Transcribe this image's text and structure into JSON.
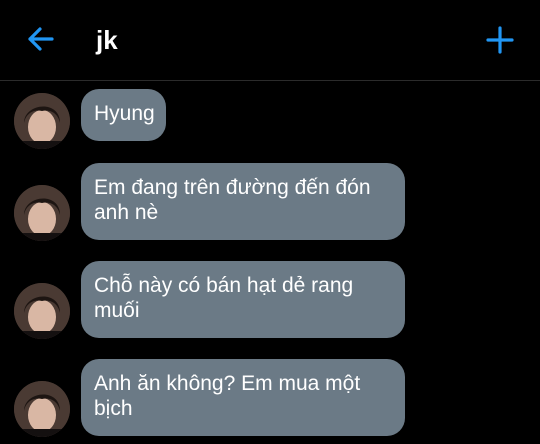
{
  "header": {
    "title": "jk",
    "accent_color": "#2196f3",
    "back_icon": "arrow-left-icon",
    "add_icon": "plus-icon"
  },
  "colors": {
    "background": "#000000",
    "bubble": "#6b7a86",
    "text": "#ffffff"
  },
  "messages": [
    {
      "lines": [
        "Hyung"
      ]
    },
    {
      "lines": [
        "Em đang trên đường đến đón",
        "anh nè"
      ]
    },
    {
      "lines": [
        "Chỗ này có bán hạt dẻ rang",
        "muối"
      ]
    },
    {
      "lines": [
        "Anh ăn không? Em mua một",
        "bịch"
      ]
    }
  ]
}
